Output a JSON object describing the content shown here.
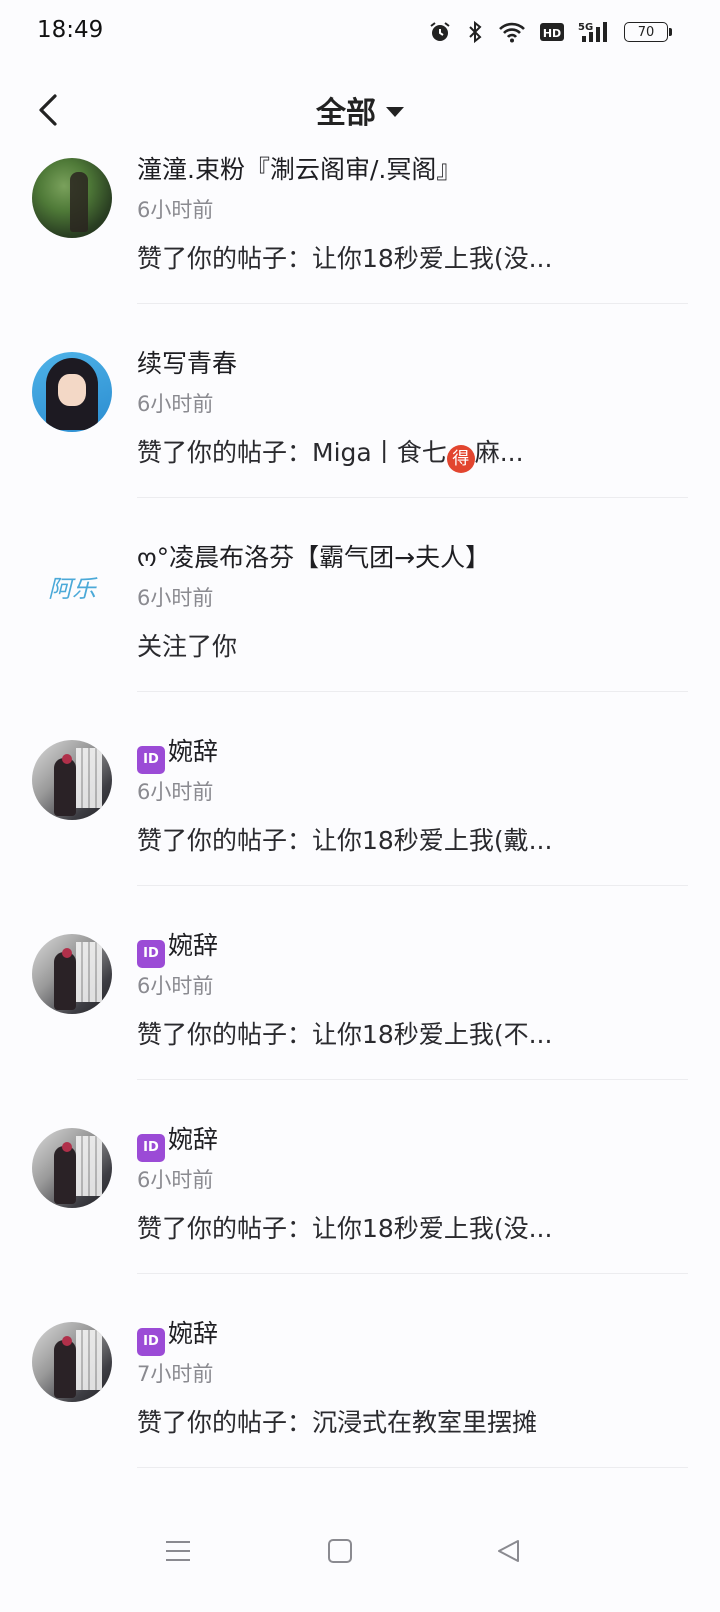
{
  "status_bar": {
    "time": "18:49",
    "battery": "70",
    "icons": [
      "alarm-icon",
      "bluetooth-icon",
      "wifi-icon",
      "hd-icon",
      "5g-signal-icon",
      "battery-icon"
    ],
    "hd_label": "HD",
    "net_label": "5G"
  },
  "header": {
    "title": "全部",
    "icons": [
      "back-arrow-icon",
      "dropdown-caret-icon"
    ]
  },
  "notifications": [
    {
      "name": "潼潼.束粉『淛云阁审/.冥阁』",
      "time": "6小时前",
      "action": "赞了你的帖子：让你18秒爱上我(没..."
    },
    {
      "name": "续写青春",
      "time": "6小时前",
      "action_prefix": "赞了你的帖子：Miga丨食七",
      "action_badge": "得",
      "action_suffix": "麻..."
    },
    {
      "name": "ო°凌晨布洛芬【霸气团→夫人】",
      "time": "6小时前",
      "action": "关注了你",
      "avatar_text": "阿乐"
    },
    {
      "name_badge": "ID",
      "name": "婉辞",
      "time": "6小时前",
      "action": "赞了你的帖子：让你18秒爱上我(戴..."
    },
    {
      "name_badge": "ID",
      "name": "婉辞",
      "time": "6小时前",
      "action": "赞了你的帖子：让你18秒爱上我(不..."
    },
    {
      "name_badge": "ID",
      "name": "婉辞",
      "time": "6小时前",
      "action": "赞了你的帖子：让你18秒爱上我(没..."
    },
    {
      "name_badge": "ID",
      "name": "婉辞",
      "time": "7小时前",
      "action": "赞了你的帖子：沉浸式在教室里摆摊"
    }
  ],
  "nav_bar": {
    "icons": [
      "menu-icon",
      "home-square-icon",
      "back-triangle-icon"
    ]
  },
  "colors": {
    "background": "#fcfcfe",
    "id_badge": "#9b4bd6",
    "de_badge": "#e2452f",
    "secondary_text": "#8a8a90"
  }
}
